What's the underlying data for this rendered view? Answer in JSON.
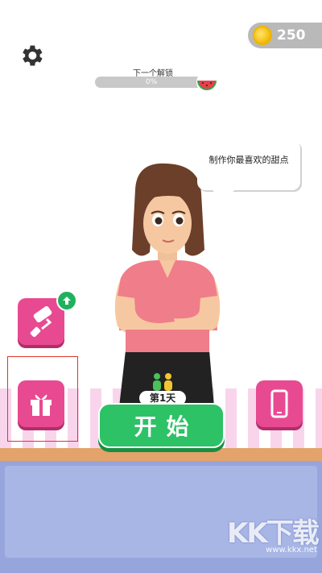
{
  "hud": {
    "coins": "250",
    "unlock_label": "下一个解锁",
    "unlock_progress_text": "0%",
    "unlock_progress": 0
  },
  "dialog": {
    "speech": "制作你最喜欢的甜点"
  },
  "start": {
    "day_label": "第1天",
    "button_label": "开始"
  },
  "icons": {
    "settings": "gear-icon",
    "coin": "coin-icon",
    "unlock_item": "watermelon-icon",
    "paint": "paint-roller-icon",
    "upgrade": "arrow-up-icon",
    "gift": "gift-icon",
    "phone": "phone-icon",
    "customers": "people-icon"
  },
  "colors": {
    "accent_pink": "#e84a92",
    "start_green": "#2ec266",
    "badge_green": "#1fb15e",
    "highlight_red": "#e0352b"
  },
  "watermark": {
    "logo": "KK下载",
    "url": "www.kkx.net"
  }
}
